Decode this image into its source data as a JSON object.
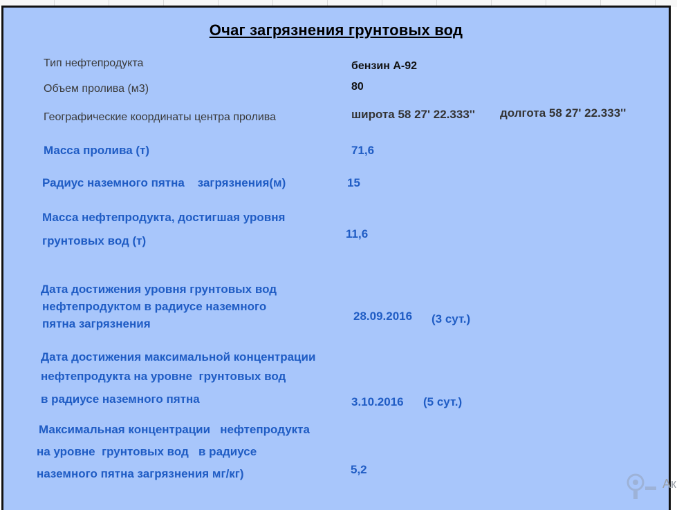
{
  "title": "Очаг загрязнения грунтовых вод",
  "rows": {
    "product_type": {
      "label": "Тип нефтепродукта",
      "value": "бензин А-92"
    },
    "spill_volume": {
      "label": "Объем пролива (м3)",
      "value": "80"
    },
    "coords": {
      "label": "Географические координаты центра пролива",
      "latitude": "широта 58 27' 22.333''",
      "longitude": "долгота 58 27' 22.333''"
    },
    "spill_mass": {
      "label": "Масса пролива (т)",
      "value": "71,6"
    },
    "spot_radius": {
      "label": "Радиус наземного пятна    загрязнения(м)",
      "value": "15"
    },
    "mass_reached": {
      "label_line1": "Масса нефтепродукта, достигшая уровня",
      "label_line2": "грунтовых вод (т)",
      "value": "11,6"
    },
    "date_reached": {
      "label_line1": "Дата достижения уровня грунтовых вод",
      "label_line2": "нефтепродуктом в радиусе наземного",
      "label_line3": "пятна загрязнения",
      "value": "28.09.2016",
      "days": "(3 сут.)"
    },
    "date_max_conc": {
      "label_line1": "Дата достижения максимальной концентрации",
      "label_line2": "нефтепродукта на уровне  грунтовых вод",
      "label_line3": "в радиусе наземного пятна",
      "value": "3.10.2016",
      "days": "(5 сут.)"
    },
    "max_conc": {
      "label_line1": "Максимальная концентрации   нефтепродукта",
      "label_line2": "на уровне  грунтовых вод   в радиусе",
      "label_line3": "наземного пятна загрязнения мг/кг)",
      "value": "5,2"
    }
  },
  "watermark_text": "Ак"
}
